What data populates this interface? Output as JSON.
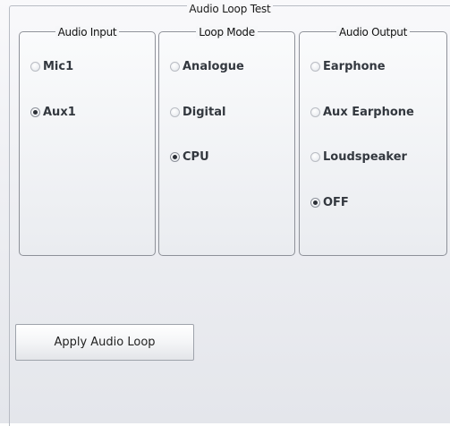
{
  "group_title": "Audio Loop Test",
  "audio_input": {
    "title": "Audio Input",
    "options": [
      {
        "label": "Mic1",
        "checked": false
      },
      {
        "label": "Aux1",
        "checked": true
      }
    ]
  },
  "loop_mode": {
    "title": "Loop Mode",
    "options": [
      {
        "label": "Analogue",
        "checked": false
      },
      {
        "label": "Digital",
        "checked": false
      },
      {
        "label": "CPU",
        "checked": true
      }
    ]
  },
  "audio_output": {
    "title": "Audio Output",
    "options": [
      {
        "label": "Earphone",
        "checked": false
      },
      {
        "label": "Aux Earphone",
        "checked": false
      },
      {
        "label": "Loudspeaker",
        "checked": false
      },
      {
        "label": "OFF",
        "checked": true
      }
    ]
  },
  "apply_button_label": "Apply Audio Loop"
}
